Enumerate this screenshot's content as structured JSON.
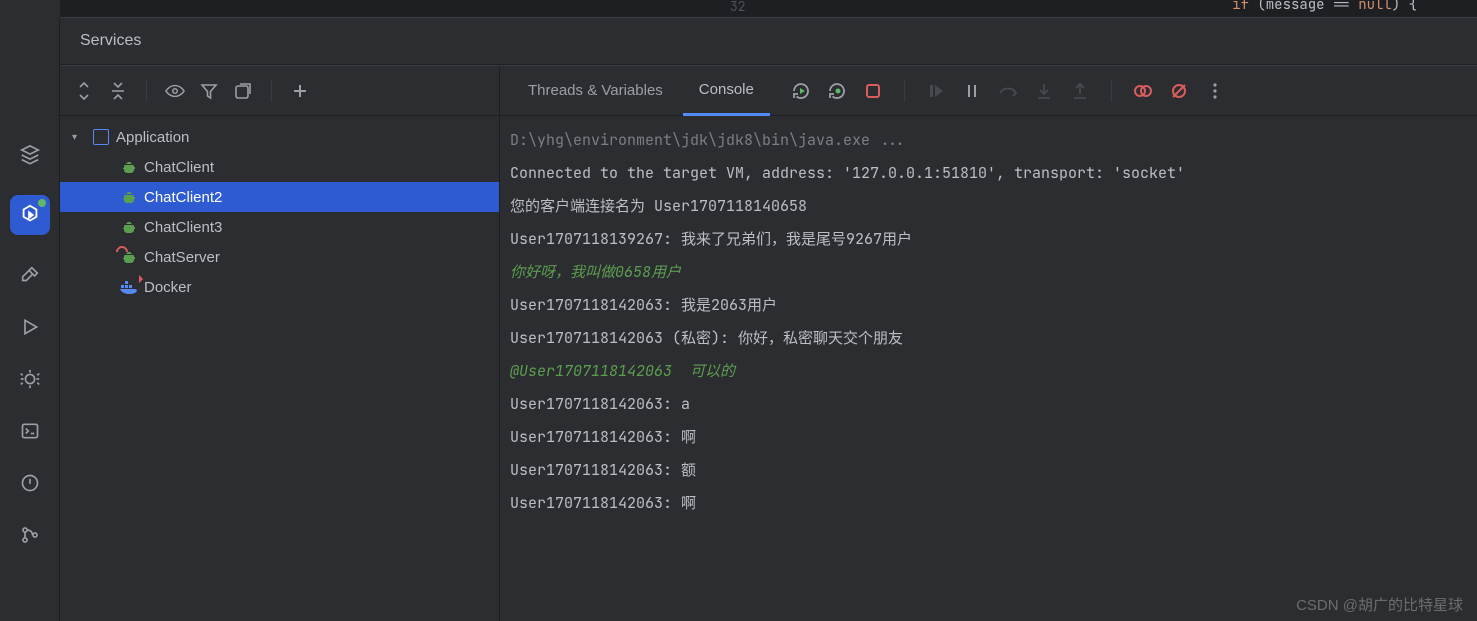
{
  "editor": {
    "line_number": "32",
    "code_prefix": "if",
    "code_mid": " (message == ",
    "code_null": "null",
    "code_end": ") {"
  },
  "panel": {
    "title": "Services"
  },
  "tree": {
    "root": "Application",
    "items": [
      {
        "label": "ChatClient",
        "state": "normal"
      },
      {
        "label": "ChatClient2",
        "state": "selected"
      },
      {
        "label": "ChatClient3",
        "state": "normal"
      },
      {
        "label": "ChatServer",
        "state": "error"
      }
    ],
    "docker": "Docker"
  },
  "tabs": {
    "threads": "Threads & Variables",
    "console": "Console"
  },
  "console": {
    "lines": [
      {
        "text": "D:\\yhg\\environment\\jdk\\jdk8\\bin\\java.exe ...",
        "cls": "dim"
      },
      {
        "text": "Connected to the target VM, address: '127.0.0.1:51810', transport: 'socket'",
        "cls": ""
      },
      {
        "text": "您的客户端连接名为 User1707118140658",
        "cls": ""
      },
      {
        "text": "User1707118139267: 我来了兄弟们，我是尾号9267用户",
        "cls": ""
      },
      {
        "text": "你好呀，我叫做0658用户",
        "cls": "green-italic"
      },
      {
        "text": "User1707118142063: 我是2063用户",
        "cls": ""
      },
      {
        "text": "User1707118142063 (私密): 你好，私密聊天交个朋友",
        "cls": ""
      },
      {
        "text": "@User1707118142063  可以的",
        "cls": "green-italic"
      },
      {
        "text": "User1707118142063: a",
        "cls": ""
      },
      {
        "text": "User1707118142063: 啊",
        "cls": ""
      },
      {
        "text": "User1707118142063: 额",
        "cls": ""
      },
      {
        "text": "User1707118142063: 啊",
        "cls": ""
      }
    ]
  },
  "watermark": "CSDN @胡广的比特星球"
}
